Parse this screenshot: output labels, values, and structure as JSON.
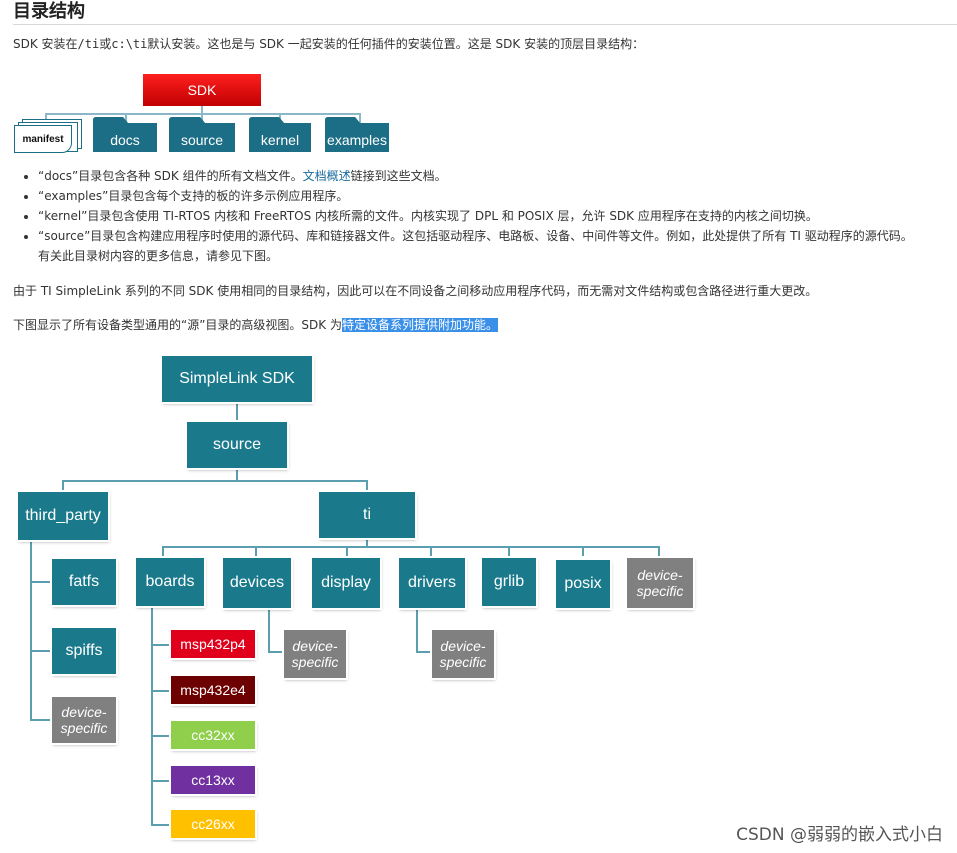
{
  "heading": "目录结构",
  "intro": {
    "p1": "SDK 安装在",
    "code1": "/ti",
    "p2": "或",
    "code2": "c:\\ti",
    "p3": "默认安装。这也是与 SDK 一起安装的任何插件的安装位置。这是 SDK 安装的顶层目录结构："
  },
  "small_diagram": {
    "root": "SDK",
    "folders": [
      "manifest",
      "docs",
      "source",
      "kernel",
      "examples"
    ],
    "colors": {
      "root": "#e00000",
      "folder": "#1c6e86",
      "manifest_border": "#1c6e86"
    }
  },
  "bullets": [
    {
      "pre": "“docs”目录包含各种 SDK 组件的所有文档文件。",
      "link": "文档概述",
      "post": "链接到这些文档。"
    },
    {
      "text": "“examples”目录包含每个支持的板的许多示例应用程序。"
    },
    {
      "text": "“kernel”目录包含使用 TI-RTOS 内核和 FreeRTOS 内核所需的文件。内核实现了 DPL 和 POSIX 层，允许 SDK 应用程序在支持的内核之间切换。"
    },
    {
      "text": "“source”目录包含构建应用程序时使用的源代码、库和链接器文件。这包括驱动程序、电路板、设备、中间件等文件。例如，此处提供了所有 TI 驱动程序的源代码。",
      "line2": "有关此目录树内容的更多信息，请参见下图。"
    }
  ],
  "para2": "由于 TI SimpleLink 系列的不同 SDK 使用相同的目录结构，因此可以在不同设备之间移动应用程序代码，而无需对文件结构或包含路径进行重大更改。",
  "para3": {
    "pre": "下图显示了所有设备类型通用的“源”目录的高级视图。SDK 为",
    "highlight": "特定设备系列提供附加功能。"
  },
  "tree": {
    "root": "SimpleLink SDK",
    "source": "source",
    "third_party": "third_party",
    "ti": "ti",
    "third_party_children": [
      "fatfs",
      "spiffs",
      "device-specific"
    ],
    "ti_children": [
      "boards",
      "devices",
      "display",
      "drivers",
      "grlib",
      "posix",
      "device-specific"
    ],
    "boards_children": [
      "msp432p4",
      "msp432e4",
      "cc32xx",
      "cc13xx",
      "cc26xx"
    ],
    "devices_children": [
      "device-specific"
    ],
    "drivers_children": [
      "device-specific"
    ],
    "colors": {
      "teal": "#1a7a8c",
      "gray": "#808080",
      "msp432p4": "#e0001b",
      "msp432e4": "#6d0000",
      "cc32xx": "#8fcf4c",
      "cc13xx": "#7030a0",
      "cc26xx": "#ffc000"
    }
  },
  "watermark": "CSDN @弱弱的嵌入式小白"
}
